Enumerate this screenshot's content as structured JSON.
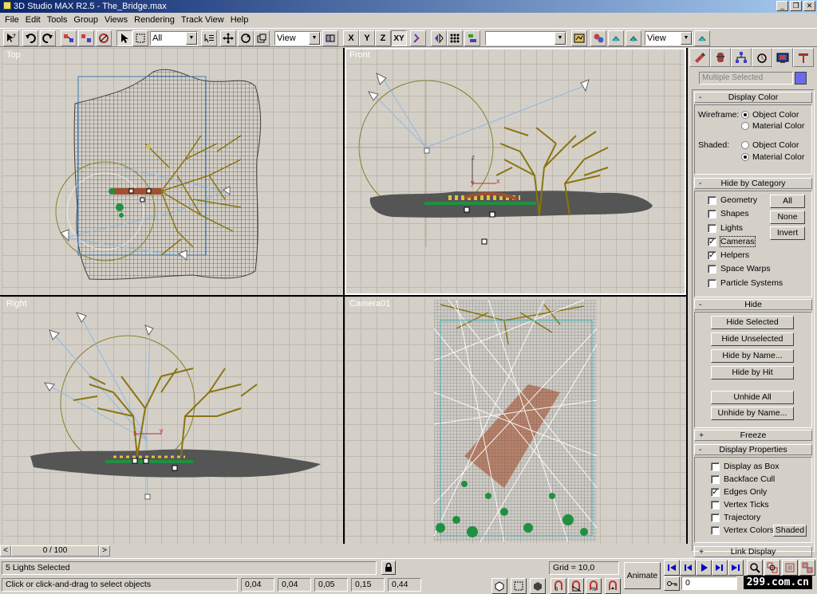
{
  "window": {
    "title": "3D Studio MAX R2.5 - The_Bridge.max"
  },
  "menu": [
    "File",
    "Edit",
    "Tools",
    "Group",
    "Views",
    "Rendering",
    "Track View",
    "Help"
  ],
  "toolbar": {
    "selection_filter": "All",
    "ref_coord_1": "View",
    "axis_x": "X",
    "axis_y": "Y",
    "axis_z": "Z",
    "axis_xy": "XY",
    "named_selection": "",
    "ref_coord_2": "View"
  },
  "viewports": {
    "top": "Top",
    "front": "Front",
    "right": "Right",
    "camera": "Camera01"
  },
  "command_panel": {
    "selection_name": "Multiple Selected",
    "selection_color": "#6a6aee",
    "display_color": {
      "title": "Display Color",
      "wireframe_label": "Wireframe:",
      "shaded_label": "Shaded:",
      "object_color": "Object Color",
      "material_color": "Material Color",
      "wireframe_selected": "Object Color",
      "shaded_selected": "Material Color"
    },
    "hide_by_category": {
      "title": "Hide by Category",
      "items": [
        {
          "label": "Geometry",
          "checked": false
        },
        {
          "label": "Shapes",
          "checked": false
        },
        {
          "label": "Lights",
          "checked": false
        },
        {
          "label": "Cameras",
          "checked": true
        },
        {
          "label": "Helpers",
          "checked": true
        },
        {
          "label": "Space Warps",
          "checked": false
        },
        {
          "label": "Particle Systems",
          "checked": false
        }
      ],
      "btn_all": "All",
      "btn_none": "None",
      "btn_invert": "Invert"
    },
    "hide": {
      "title": "Hide",
      "hide_selected": "Hide Selected",
      "hide_unselected": "Hide Unselected",
      "hide_by_name": "Hide by Name...",
      "hide_by_hit": "Hide by Hit",
      "unhide_all": "Unhide All",
      "unhide_by_name": "Unhide by Name..."
    },
    "freeze": {
      "title": "Freeze"
    },
    "display_properties": {
      "title": "Display Properties",
      "items": [
        {
          "label": "Display as Box",
          "checked": false
        },
        {
          "label": "Backface Cull",
          "checked": false
        },
        {
          "label": "Edges Only",
          "checked": true
        },
        {
          "label": "Vertex Ticks",
          "checked": false
        },
        {
          "label": "Trajectory",
          "checked": false
        },
        {
          "label": "Vertex Colors",
          "checked": false
        }
      ],
      "shaded_btn": "Shaded"
    },
    "link_display": {
      "title": "Link Display"
    }
  },
  "time_slider": {
    "label": "0 / 100",
    "prev": "<",
    "next": ">"
  },
  "status": {
    "selection": "5 Lights Selected",
    "prompt": "Click or click-and-drag to select objects",
    "grid": "Grid = 10,0",
    "coords": [
      "0,04",
      "0,04",
      "0,05",
      "0,15",
      "0,44"
    ],
    "animate": "Animate",
    "frame": "0",
    "watermark": "299.com.cn"
  },
  "colors": {
    "bg": "#d4d0c8",
    "tree": "#8a7410",
    "ground": "#555555",
    "wire": "#505050"
  }
}
